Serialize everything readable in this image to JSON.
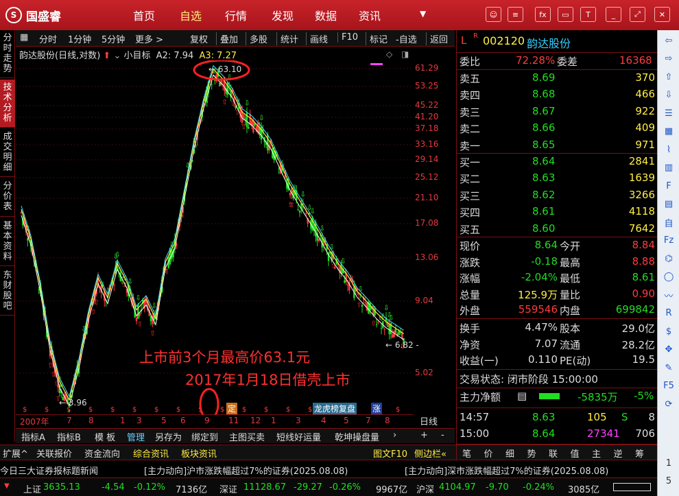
{
  "top_nav": {
    "logo": "国盛睿",
    "items": [
      "首页",
      "自选",
      "行情",
      "发现",
      "数据",
      "资讯"
    ],
    "active": "自选",
    "buttons": [
      "message-icon",
      "settings-icon",
      "fx-icon",
      "monitor-icon",
      "shirt-icon",
      "minimize-icon",
      "restore-icon",
      "close-icon"
    ]
  },
  "left_tabs": [
    "分时走势",
    "技术分析",
    "成交明细",
    "分价表",
    "基本资料",
    "东财股吧"
  ],
  "chart_toolbar": [
    "分时",
    "1分钟",
    "5分钟",
    "更多 >",
    "复权",
    "叠加",
    "多股",
    "统计",
    "画线",
    "F10",
    "标记",
    "-自选",
    "返回"
  ],
  "chart_info": {
    "title": "韵达股份(日线,对数)",
    "indicator": "小目标",
    "a2_label": "A2: 7.94",
    "a3_label": "A3: 7.27"
  },
  "y_axis_labels": [
    "61.29",
    "53.25",
    "45.22",
    "41.20",
    "37.18",
    "33.16",
    "29.14",
    "25.12",
    "21.10",
    "17.08",
    "13.06",
    "9.04",
    "5.02"
  ],
  "x_axis_labels": [
    "2007年",
    "7",
    "8",
    "1",
    "3",
    "5",
    "6",
    "9",
    "11",
    "12",
    "1",
    "3",
    "4",
    "5",
    "7",
    "8"
  ],
  "period": "日线",
  "markers": {
    "high": "63.10",
    "low": "3.96",
    "last": "6.82"
  },
  "annotations": {
    "line1": "上市前3个月最高价63.1元",
    "line2": "2017年1月18日借壳上市",
    "chip_ding": "定",
    "chip_lhb": "龙虎榜复盘",
    "chip_limit": "涨"
  },
  "indicator_tabs": [
    "指标A",
    "指标B",
    "模 板",
    "管理",
    "另存为",
    "绑定到",
    "主图买卖",
    "短线好运量",
    "乾坤操盘量"
  ],
  "indicator_tabs_active": "管理",
  "indicator_tab_buttons": [
    "+",
    "-"
  ],
  "bottom_tabs": [
    "扩展^",
    "关联报价",
    "资金流向",
    "综合资讯",
    "板块资讯"
  ],
  "bottom_right_tabs": [
    "图文F10",
    "侧边栏«"
  ],
  "quote_panel_tabs": [
    "笔",
    "价",
    "细",
    "势",
    "联",
    "值",
    "主",
    "逆",
    "筹"
  ],
  "stock": {
    "code": "002120",
    "name": "韵达股份",
    "prefix": "L",
    "prefix2": "R"
  },
  "order_book": {
    "weibi_label": "委比",
    "weibi_value": "72.28%",
    "weicha_label": "委差",
    "weicha_value": "16368",
    "asks": [
      {
        "label": "卖五",
        "price": "8.69",
        "vol": "370"
      },
      {
        "label": "卖四",
        "price": "8.68",
        "vol": "466"
      },
      {
        "label": "卖三",
        "price": "8.67",
        "vol": "922"
      },
      {
        "label": "卖二",
        "price": "8.66",
        "vol": "409"
      },
      {
        "label": "卖一",
        "price": "8.65",
        "vol": "971"
      }
    ],
    "bids": [
      {
        "label": "买一",
        "price": "8.64",
        "vol": "2841"
      },
      {
        "label": "买二",
        "price": "8.63",
        "vol": "1639"
      },
      {
        "label": "买三",
        "price": "8.62",
        "vol": "3266"
      },
      {
        "label": "买四",
        "price": "8.61",
        "vol": "4118"
      },
      {
        "label": "买五",
        "price": "8.60",
        "vol": "7642"
      }
    ]
  },
  "stats": [
    {
      "l1": "现价",
      "v1": "8.64",
      "l2": "今开",
      "v2": "8.84"
    },
    {
      "l1": "涨跌",
      "v1": "-0.18",
      "l2": "最高",
      "v2": "8.88"
    },
    {
      "l1": "涨幅",
      "v1": "-2.04%",
      "l2": "最低",
      "v2": "8.61"
    },
    {
      "l1": "总量",
      "v1": "125.9万",
      "l2": "量比",
      "v2": "0.90"
    },
    {
      "l1": "外盘",
      "v1": "559546",
      "l2": "内盘",
      "v2": "699842"
    }
  ],
  "fundamentals": [
    {
      "l1": "换手",
      "v1": "4.47%",
      "l2": "股本",
      "v2": "29.0亿"
    },
    {
      "l1": "净资",
      "v1": "7.07",
      "l2": "流通",
      "v2": "28.2亿"
    },
    {
      "l1": "收益(一)",
      "v1": "0.110",
      "l2": "PE(动)",
      "v2": "19.5"
    }
  ],
  "trade_status": "交易状态: 闭市阶段 15:00:00",
  "net_flow": {
    "label": "主力净额",
    "value": "-5835万",
    "pct": "-5%"
  },
  "ticks": [
    {
      "time": "14:57",
      "price": "8.63",
      "vol": "105",
      "flag": "S",
      "n": "8"
    },
    {
      "time": "15:00",
      "price": "8.64",
      "vol": "27341",
      "flag": "",
      "n": "706"
    }
  ],
  "ticker": {
    "left": "今日三大证券报标题新闻",
    "items": [
      "[主力动向]沪市涨跌幅超过7%的证券(2025.08.08)",
      "[主力动向]深市涨跌幅超过7%的证券(2025.08.08)"
    ]
  },
  "status_bar": {
    "sh_label": "上证",
    "sh_value": "3635.13",
    "sh_change": "-4.54",
    "sh_pct": "-0.12%",
    "sh_amount": "7136亿",
    "sz_label": "深证",
    "sz_value": "11128.67",
    "sz_change": "-29.27",
    "sz_pct": "-0.26%",
    "sz_amount": "9967亿",
    "hs_label": "沪深",
    "hs_value": "4104.97",
    "hs_change": "-9.70",
    "hs_pct": "-0.24%",
    "hs_amount": "3085亿"
  },
  "right_toolbar": [
    "arrow-left-icon",
    "arrow-right-icon",
    "arrow-up-icon",
    "arrow-down-icon",
    "list-icon",
    "grid-icon",
    "line-chart-icon",
    "candle-icon",
    "f10-icon",
    "doc-icon",
    "self-icon",
    "fiz-icon",
    "compass-icon",
    "circle-icon",
    "wave-icon",
    "rsi-icon",
    "dollar-icon",
    "move-icon",
    "pen-icon",
    "f5-icon",
    "refresh-icon"
  ],
  "right_toolbar_bottom": [
    "1",
    "5"
  ],
  "colors": {
    "up": "#ff3c3c",
    "down": "#22dd22",
    "brand": "#c8232a",
    "highlight": "#ffee44"
  },
  "chart_data": {
    "type": "candlestick",
    "scale": "log",
    "ylim": [
      3.8,
      66
    ],
    "x": [
      "2007年",
      "7",
      "8",
      "1",
      "3",
      "5",
      "6",
      "9",
      "11",
      "12",
      "1",
      "3",
      "4",
      "5",
      "7",
      "8"
    ],
    "close": [
      19.5,
      15.2,
      10.2,
      6.3,
      4.6,
      3.96,
      5.4,
      8.1,
      11.0,
      9.3,
      12.4,
      10.6,
      8.4,
      9.2,
      7.8,
      12.5,
      14.8,
      22.5,
      34.0,
      48.0,
      63.1,
      58.0,
      52.0,
      44.0,
      41.5,
      38.0,
      34.0,
      28.5,
      24.0,
      21.0,
      18.5,
      16.2,
      14.0,
      12.4,
      11.2,
      9.8,
      9.0,
      8.2,
      7.6,
      7.2,
      6.82
    ]
  }
}
